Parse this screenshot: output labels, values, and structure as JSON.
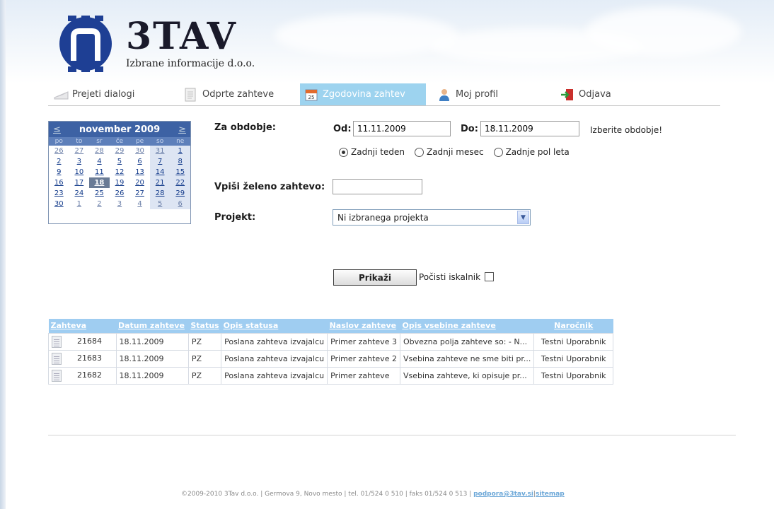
{
  "logo": {
    "brand": "3TAV",
    "subtitle": "Izbrane informacije d.o.o."
  },
  "nav": {
    "items": [
      {
        "label": "Prejeti dialogi",
        "icon": "envelope-icon"
      },
      {
        "label": "Odprte zahteve",
        "icon": "document-icon"
      },
      {
        "label": "Zgodovina zahtev",
        "icon": "calendar-icon",
        "active": true
      },
      {
        "label": "Moj profil",
        "icon": "user-icon"
      },
      {
        "label": "Odjava",
        "icon": "logout-icon"
      }
    ]
  },
  "calendar": {
    "title": "november 2009",
    "prev": "≤",
    "next": "≥",
    "days_of_week": [
      "po",
      "to",
      "sr",
      "če",
      "pe",
      "so",
      "ne"
    ],
    "weeks": [
      [
        "26",
        "27",
        "28",
        "29",
        "30",
        "31",
        "1"
      ],
      [
        "2",
        "3",
        "4",
        "5",
        "6",
        "7",
        "8"
      ],
      [
        "9",
        "10",
        "11",
        "12",
        "13",
        "14",
        "15"
      ],
      [
        "16",
        "17",
        "18",
        "19",
        "20",
        "21",
        "22"
      ],
      [
        "23",
        "24",
        "25",
        "26",
        "27",
        "28",
        "29"
      ],
      [
        "30",
        "1",
        "2",
        "3",
        "4",
        "5",
        "6"
      ]
    ],
    "selected": "18"
  },
  "form": {
    "period_label": "Za obdobje:",
    "from_label": "Od:",
    "from_value": "11.11.2009",
    "to_label": "Do:",
    "to_value": "18.11.2009",
    "hint": "Izberite obdobje!",
    "radios": [
      {
        "label": "Zadnji teden",
        "checked": true
      },
      {
        "label": "Zadnji mesec",
        "checked": false
      },
      {
        "label": "Zadnje pol leta",
        "checked": false
      }
    ],
    "request_label": "Vpiši želeno zahtevo:",
    "request_value": "",
    "project_label": "Projekt:",
    "project_selected": "Ni izbranega projekta",
    "show_button": "Prikaži",
    "clear_label": "Počisti iskalnik"
  },
  "table": {
    "columns": [
      "Zahteva",
      "Datum zahteve",
      "Status",
      "Opis statusa",
      "Naslov zahteve",
      "Opis vsebine zahteve",
      "Naročnik"
    ],
    "rows": [
      {
        "id": "21684",
        "date": "18.11.2009",
        "status": "PZ",
        "status_desc": "Poslana zahteva izvajalcu",
        "title": "Primer zahteve 3",
        "content": "Obvezna polja zahteve so: - N...",
        "client": "Testni Uporabnik"
      },
      {
        "id": "21683",
        "date": "18.11.2009",
        "status": "PZ",
        "status_desc": "Poslana zahteva izvajalcu",
        "title": "Primer zahteve 2",
        "content": "Vsebina zahteve ne sme biti pr...",
        "client": "Testni Uporabnik"
      },
      {
        "id": "21682",
        "date": "18.11.2009",
        "status": "PZ",
        "status_desc": "Poslana zahteva izvajalcu",
        "title": "Primer zahteve",
        "content": "Vsebina zahteve, ki opisuje pr...",
        "client": "Testni Uporabnik"
      }
    ]
  },
  "footer": {
    "text": "©2009-2010 3Tav d.o.o. | Germova 9, Novo mesto | tel. 01/524 0 510 | faks 01/524 0 513 | ",
    "email": "podpora@3tav.si",
    "sep": "|",
    "sitemap": "sitemap"
  },
  "colors": {
    "nav_active": "#9dd3ef",
    "calendar_header": "#3d62a4",
    "table_header": "#9fcdf1"
  }
}
